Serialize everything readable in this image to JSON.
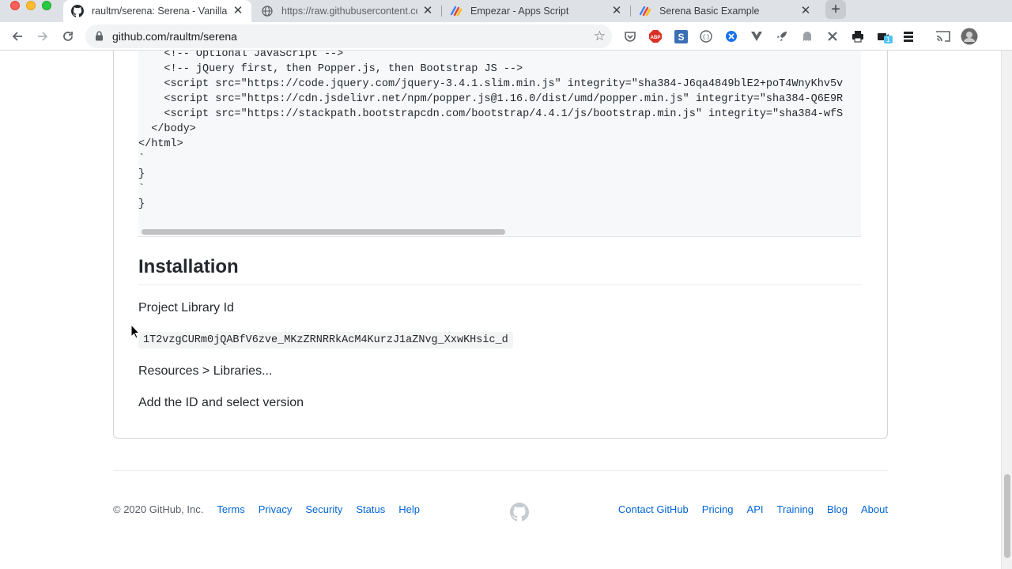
{
  "tabs": [
    {
      "title": "raultm/serena: Serena - Vanilla",
      "icon": "github-icon",
      "active": true
    },
    {
      "title": "https://raw.githubusercontent.com",
      "icon": "globe-icon",
      "active": false
    },
    {
      "title": "Empezar - Apps Script",
      "icon": "apps-script-icon",
      "active": false
    },
    {
      "title": "Serena Basic Example",
      "icon": "apps-script-icon",
      "active": false
    }
  ],
  "toolbar": {
    "url": "github.com/raultm/serena",
    "extension_badge": "1"
  },
  "code": {
    "lines": [
      "    <!-- Optional JavaScript -->",
      "    <!-- jQuery first, then Popper.js, then Bootstrap JS -->",
      "    <script src=\"https://code.jquery.com/jquery-3.4.1.slim.min.js\" integrity=\"sha384-J6qa4849blE2+poT4WnyKhv5v",
      "    <script src=\"https://cdn.jsdelivr.net/npm/popper.js@1.16.0/dist/umd/popper.min.js\" integrity=\"sha384-Q6E9R",
      "    <script src=\"https://stackpath.bootstrapcdn.com/bootstrap/4.4.1/js/bootstrap.min.js\" integrity=\"sha384-wfS",
      "  </body>",
      "</html>",
      "`",
      "}",
      "`",
      "}"
    ]
  },
  "readme": {
    "heading": "Installation",
    "library_label": "Project Library Id",
    "library_id": "1T2vzgCURm0jQABfV6zve_MKzZRNRRkAcM4KurzJ1aZNvg_XxwKHsic_d",
    "step_resources": "Resources > Libraries...",
    "step_add": "Add the ID and select version"
  },
  "footer": {
    "copyright": "© 2020 GitHub, Inc.",
    "left_links": [
      "Terms",
      "Privacy",
      "Security",
      "Status",
      "Help"
    ],
    "right_links": [
      "Contact GitHub",
      "Pricing",
      "API",
      "Training",
      "Blog",
      "About"
    ]
  },
  "colors": {
    "link": "#0366d6",
    "text": "#24292e",
    "code_bg": "#f6f8fa"
  }
}
